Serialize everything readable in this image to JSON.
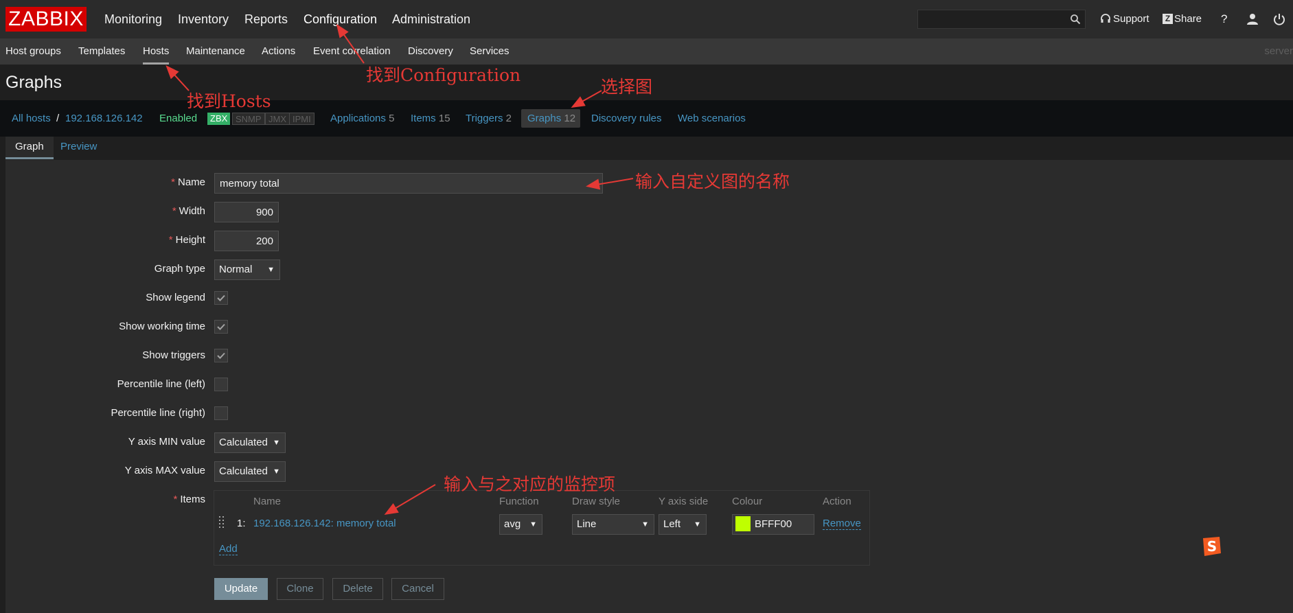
{
  "top": {
    "logo": "ZABBIX",
    "menu": [
      "Monitoring",
      "Inventory",
      "Reports",
      "Configuration",
      "Administration"
    ],
    "active_menu": "Configuration",
    "search_value": "",
    "support": "Support",
    "share": "Share",
    "help": "?"
  },
  "sub": {
    "items": [
      "Host groups",
      "Templates",
      "Hosts",
      "Maintenance",
      "Actions",
      "Event correlation",
      "Discovery",
      "Services"
    ],
    "active": "Hosts",
    "server": "server"
  },
  "page_title": "Graphs",
  "host_nav": {
    "all_hosts": "All hosts",
    "separator": "/",
    "host": "192.168.126.142",
    "enabled": "Enabled",
    "availability": [
      "ZBX",
      "SNMP",
      "JMX",
      "IPMI"
    ],
    "applications": {
      "label": "Applications",
      "count": "5"
    },
    "items": {
      "label": "Items",
      "count": "15"
    },
    "triggers": {
      "label": "Triggers",
      "count": "2"
    },
    "graphs": {
      "label": "Graphs",
      "count": "12"
    },
    "discovery_rules": "Discovery rules",
    "web_scenarios": "Web scenarios"
  },
  "tabs": [
    "Graph",
    "Preview"
  ],
  "form": {
    "required_mark": "*",
    "name_label": "Name",
    "name_value": "memory total",
    "width_label": "Width",
    "width_value": "900",
    "height_label": "Height",
    "height_value": "200",
    "graph_type_label": "Graph type",
    "graph_type_value": "Normal",
    "show_legend_label": "Show legend",
    "show_legend": true,
    "show_working_time_label": "Show working time",
    "show_working_time": true,
    "show_triggers_label": "Show triggers",
    "show_triggers": true,
    "percentile_left_label": "Percentile line (left)",
    "percentile_left": false,
    "percentile_right_label": "Percentile line (right)",
    "percentile_right": false,
    "ymin_label": "Y axis MIN value",
    "ymin_value": "Calculated",
    "ymax_label": "Y axis MAX value",
    "ymax_value": "Calculated",
    "items_label": "Items"
  },
  "items_table": {
    "headers": [
      "Name",
      "Function",
      "Draw style",
      "Y axis side",
      "Colour",
      "Action"
    ],
    "rows": [
      {
        "num": "1:",
        "name": "192.168.126.142: memory total",
        "function": "avg",
        "draw_style": "Line",
        "y_axis_side": "Left",
        "colour": "BFFF00",
        "action": "Remove"
      }
    ],
    "add": "Add"
  },
  "buttons": {
    "update": "Update",
    "clone": "Clone",
    "delete": "Delete",
    "cancel": "Cancel"
  },
  "annotations": {
    "configuration": "找到Configuration",
    "hosts": "找到Hosts",
    "graphs": "选择图",
    "name": "输入自定义图的名称",
    "items": "输入与之对应的监控项"
  },
  "colors": {
    "accent": "#4796c4",
    "item_colour": "#BFFF00",
    "annotation": "#e53935",
    "enabled": "#59db8f"
  }
}
